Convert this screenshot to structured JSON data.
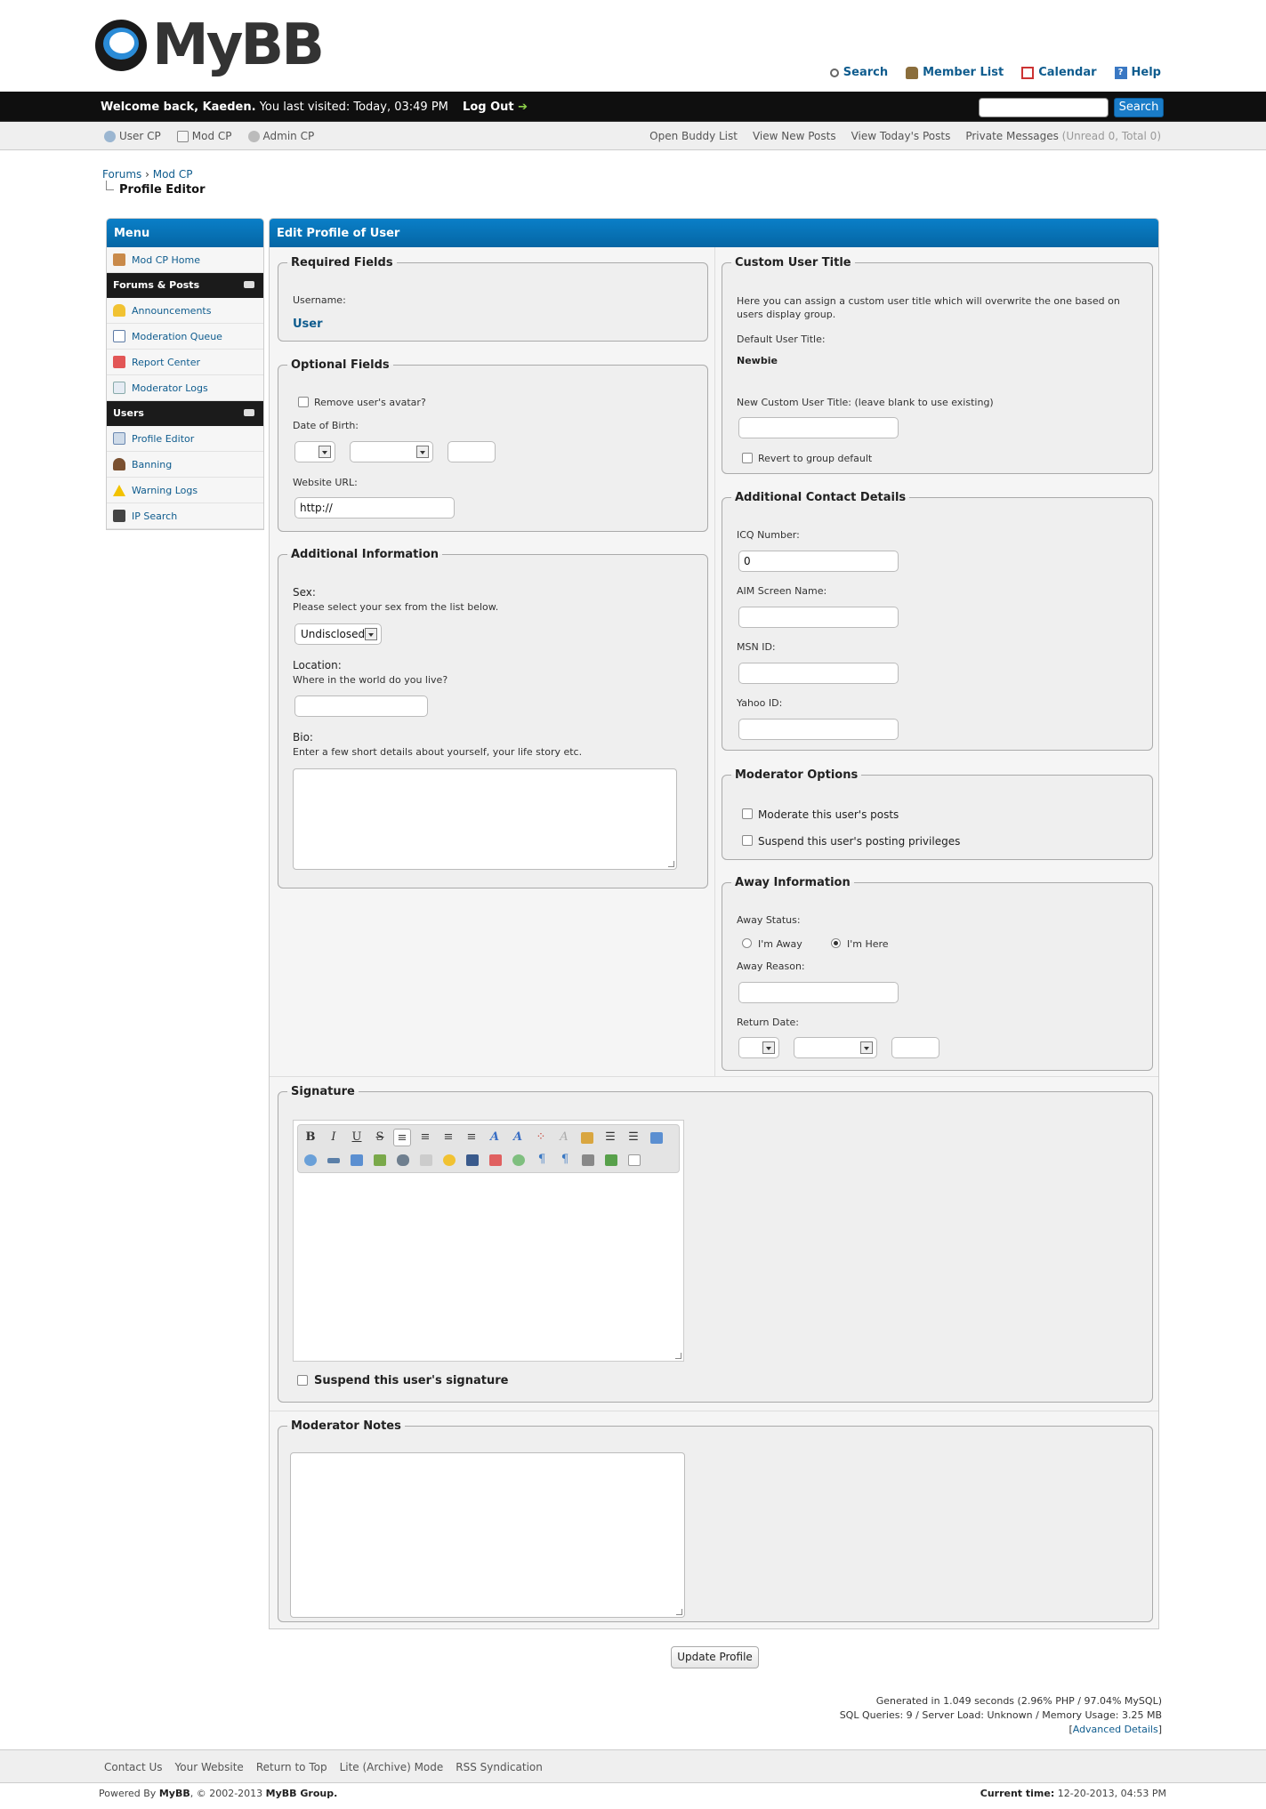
{
  "header": {
    "logo_text": "MyBB",
    "toplinks": [
      "Search",
      "Member List",
      "Calendar",
      "Help"
    ]
  },
  "welcome": {
    "greeting": "Welcome back, Kaeden.",
    "last_visit": "You last visited: Today, 03:49 PM",
    "logout": "Log Out",
    "search_button": "Search"
  },
  "panel": {
    "left": [
      "User CP",
      "Mod CP",
      "Admin CP"
    ],
    "buddy": "Open Buddy List",
    "new_posts": "View New Posts",
    "todays_posts": "View Today's Posts",
    "pm_label": "Private Messages",
    "pm_counts": "(Unread 0, Total 0)"
  },
  "breadcrumb": {
    "forums": "Forums",
    "sep": " › ",
    "modcp": "Mod CP",
    "current": "Profile Editor"
  },
  "sidebar": {
    "title": "Menu",
    "home": "Mod CP Home",
    "cat1": "Forums & Posts",
    "cat1_items": [
      "Announcements",
      "Moderation Queue",
      "Report Center",
      "Moderator Logs"
    ],
    "cat2": "Users",
    "cat2_items": [
      "Profile Editor",
      "Banning",
      "Warning Logs",
      "IP Search"
    ]
  },
  "main": {
    "title": "Edit Profile of User",
    "required": {
      "legend": "Required Fields",
      "username_label": "Username:",
      "username": "User"
    },
    "optional": {
      "legend": "Optional Fields",
      "remove_avatar": "Remove user's avatar?",
      "dob_label": "Date of Birth:",
      "website_label": "Website URL:",
      "website_value": "http://"
    },
    "additional": {
      "legend": "Additional Information",
      "sex_label": "Sex:",
      "sex_desc": "Please select your sex from the list below.",
      "sex_value": "Undisclosed",
      "location_label": "Location:",
      "location_desc": "Where in the world do you live?",
      "bio_label": "Bio:",
      "bio_desc": "Enter a few short details about yourself, your life story etc."
    },
    "custom_title": {
      "legend": "Custom User Title",
      "desc": "Here you can assign a custom user title which will overwrite the one based on users display group.",
      "default_label": "Default User Title:",
      "default_value": "Newbie",
      "new_label": "New Custom User Title: (leave blank to use existing)",
      "revert": "Revert to group default"
    },
    "contact": {
      "legend": "Additional Contact Details",
      "icq_label": "ICQ Number:",
      "icq_value": "0",
      "aim_label": "AIM Screen Name:",
      "msn_label": "MSN ID:",
      "yahoo_label": "Yahoo ID:"
    },
    "modopts": {
      "legend": "Moderator Options",
      "moderate": "Moderate this user's posts",
      "suspend": "Suspend this user's posting privileges"
    },
    "away": {
      "legend": "Away Information",
      "status_label": "Away Status:",
      "away": "I'm Away",
      "here": "I'm Here",
      "reason_label": "Away Reason:",
      "return_label": "Return Date:"
    },
    "signature": {
      "legend": "Signature",
      "suspend": "Suspend this user's signature"
    },
    "notes": {
      "legend": "Moderator Notes"
    }
  },
  "update_button": "Update Profile",
  "debug": {
    "line1": "Generated in 1.049 seconds (2.96% PHP / 97.04% MySQL)",
    "line2": "SQL Queries: 9 / Server Load: Unknown / Memory Usage: 3.25 MB",
    "advanced": "Advanced Details"
  },
  "footer": {
    "links": [
      "Contact Us",
      "Your Website",
      "Return to Top",
      "Lite (Archive) Mode",
      "RSS Syndication"
    ],
    "powered_prefix": "Powered By ",
    "powered_mybb": "MyBB",
    "powered_mid": ", © 2002-2013 ",
    "powered_group": "MyBB Group.",
    "time_label": "Current time:",
    "time_value": "12-20-2013, 04:53 PM"
  },
  "colors": {
    "accent": "#0f5c8e",
    "header_bar": "#0f0f0f",
    "thead_blue": "#0566a4"
  }
}
